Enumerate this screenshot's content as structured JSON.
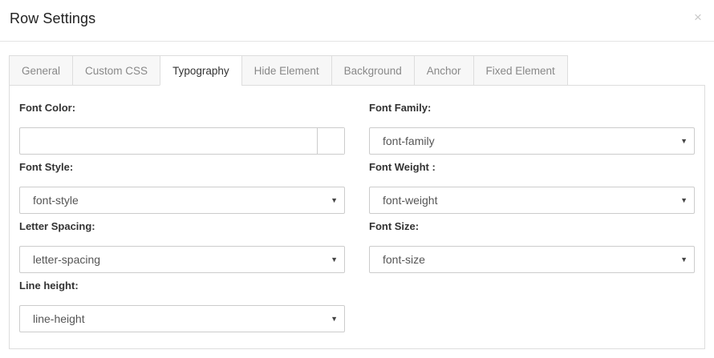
{
  "dialog": {
    "title": "Row Settings",
    "close_label": "×"
  },
  "tabs": [
    {
      "label": "General",
      "active": false
    },
    {
      "label": "Custom CSS",
      "active": false
    },
    {
      "label": "Typography",
      "active": true
    },
    {
      "label": "Hide Element",
      "active": false
    },
    {
      "label": "Background",
      "active": false
    },
    {
      "label": "Anchor",
      "active": false
    },
    {
      "label": "Fixed Element",
      "active": false
    }
  ],
  "typography": {
    "font_color": {
      "label": "Font Color:",
      "value": ""
    },
    "font_family": {
      "label": "Font Family:",
      "value": "font-family"
    },
    "font_style": {
      "label": "Font Style:",
      "value": "font-style"
    },
    "font_weight": {
      "label": "Font Weight :",
      "value": "font-weight"
    },
    "letter_spacing": {
      "label": "Letter Spacing:",
      "value": "letter-spacing"
    },
    "font_size": {
      "label": "Font Size:",
      "value": "font-size"
    },
    "line_height": {
      "label": "Line height:",
      "value": "line-height"
    }
  },
  "icons": {
    "dropdown_arrow": "▼",
    "close": "×"
  }
}
